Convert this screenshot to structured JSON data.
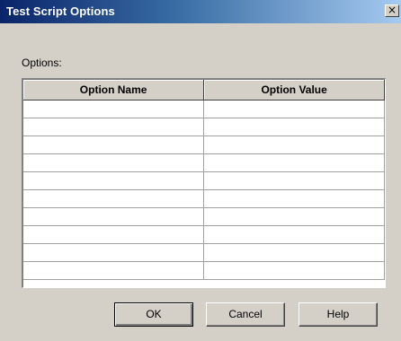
{
  "window": {
    "title": "Test Script Options",
    "close_glyph": "×"
  },
  "options": {
    "label": "Options:",
    "columns": [
      "Option Name",
      "Option Value"
    ],
    "rows": [
      [
        "",
        ""
      ],
      [
        "",
        ""
      ],
      [
        "",
        ""
      ],
      [
        "",
        ""
      ],
      [
        "",
        ""
      ],
      [
        "",
        ""
      ],
      [
        "",
        ""
      ],
      [
        "",
        ""
      ],
      [
        "",
        ""
      ],
      [
        "",
        ""
      ]
    ]
  },
  "buttons": {
    "ok": "OK",
    "cancel": "Cancel",
    "help": "Help"
  }
}
